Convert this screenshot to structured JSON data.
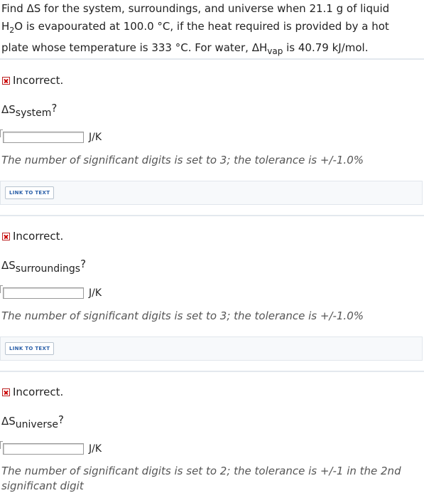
{
  "question": {
    "line1": "Find ΔS for the system, surroundings, and universe when 21.1 g of liquid",
    "line2_pre": "H",
    "line2_sub": "2",
    "line2_post": "O is evapourated at 100.0 °C, if the heat required is provided by a hot",
    "line3_pre": "plate whose temperature is 333 °C. For water, ΔH",
    "line3_sub": "vap",
    "line3_post": " is 40.79 kJ/mol."
  },
  "parts": [
    {
      "status": "Incorrect.",
      "prompt_main": "ΔS",
      "prompt_sub": "system",
      "prompt_q": "?",
      "answer_value": "",
      "unit": "J/K",
      "tolerance": "The number of significant digits is set to 3; the tolerance is +/-1.0%",
      "link_label": "LINK TO TEXT"
    },
    {
      "status": "Incorrect.",
      "prompt_main": "ΔS",
      "prompt_sub": "surroundings",
      "prompt_q": "?",
      "answer_value": "",
      "unit": "J/K",
      "tolerance": "The number of significant digits is set to 3; the tolerance is +/-1.0%",
      "link_label": "LINK TO TEXT"
    },
    {
      "status": "Incorrect.",
      "prompt_main": "ΔS",
      "prompt_sub": "universe",
      "prompt_q": "?",
      "answer_value": "",
      "unit": "J/K",
      "tolerance": "The number of significant digits is set to 2; the tolerance is +/-1 in the 2nd significant digit"
    }
  ],
  "icons": {
    "status": "incorrect-x-icon"
  },
  "colors": {
    "incorrect": "#cc0000",
    "link": "#2a5fa8",
    "rule": "#e3e8ee"
  }
}
